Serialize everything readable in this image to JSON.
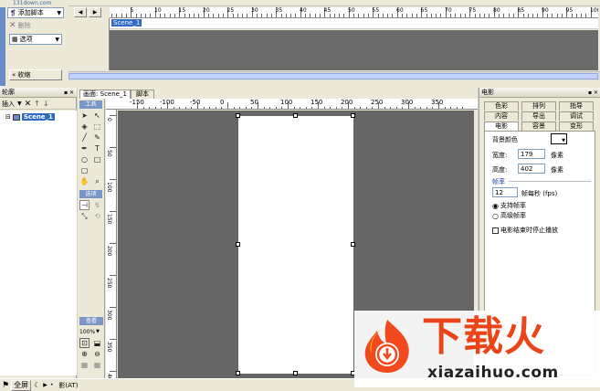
{
  "watermark_top": "131down.com",
  "actions": {
    "add_script": "添加脚本",
    "delete": "删除",
    "options": "选项",
    "collapse": "收缩"
  },
  "timeline": {
    "ruler_labels": [
      "5",
      "10",
      "15",
      "20",
      "25",
      "30",
      "35",
      "40",
      "45",
      "50",
      "55",
      "60",
      "65",
      "70",
      "75",
      "80",
      "85",
      "90",
      "95",
      "100"
    ],
    "scene_row": "Scene_1"
  },
  "outline": {
    "title": "轮廓",
    "insert": "插入",
    "scene_item": "Scene_1"
  },
  "document": {
    "tabs": [
      "画面: Scene_1",
      "脚本"
    ],
    "h_ruler": [
      "-150",
      "-100",
      "-50",
      "0",
      "50",
      "100",
      "150",
      "200",
      "250",
      "300",
      "350"
    ],
    "v_ruler": [
      "0",
      "50",
      "100",
      "150",
      "200",
      "250",
      "300",
      "350",
      "400"
    ]
  },
  "tools": {
    "section_tools": "工具",
    "section_options": "选项",
    "section_view": "查看",
    "zoom": "100%"
  },
  "movie_panel": {
    "title": "电影",
    "tabs_row1": [
      "色彩",
      "排列",
      "指导"
    ],
    "tabs_row2": [
      "内容",
      "导出",
      "调试"
    ],
    "tabs_row3": [
      "电影",
      "容景",
      "变形"
    ],
    "bg_color_label": "背景颜色",
    "width_label": "宽度:",
    "width_value": "179",
    "width_unit": "像素",
    "height_label": "高度:",
    "height_value": "402",
    "height_unit": "像素",
    "frame_rate_section": "帧率",
    "fps_value": "12",
    "fps_unit": "帧每秒 (fps)",
    "radio_constant": "支持帧率",
    "radio_high": "高级帧率",
    "stop_on_end": "电影结束时停止播放",
    "bg_color": "#ffffff"
  },
  "status": {
    "btn_all": "全屏",
    "text": "影(AT)"
  },
  "logo": {
    "cn": "下载火",
    "en": "xiazaihuo.com"
  }
}
